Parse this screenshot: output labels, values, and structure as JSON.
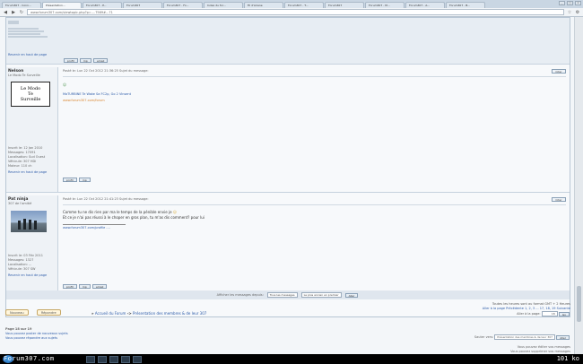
{
  "browser": {
    "tabs": [
      {
        "label": "Forum307 - Conn..."
      },
      {
        "label": "Présentation..."
      },
      {
        "label": "Forum307 - P..."
      },
      {
        "label": "Forum307"
      },
      {
        "label": "Forum307 - Fo..."
      },
      {
        "label": "Index du for..."
      },
      {
        "label": "Fil d'Ariane"
      },
      {
        "label": "Forum307 - T..."
      },
      {
        "label": "Forum307"
      },
      {
        "label": "Forum307 - M..."
      },
      {
        "label": "Forum307 - A..."
      },
      {
        "label": "Forum307 - B..."
      },
      {
        "label": "Forum307"
      },
      {
        "label": "Mes messages"
      }
    ],
    "url": "www.forum307.com/viewtopic.php?p=....7569#...71",
    "controls": [
      "_",
      "□",
      "×"
    ]
  },
  "posts": [
    {
      "author": "Nelson",
      "rank": "Le Modo Te Surveille",
      "avatar_lines": [
        "Le Modo",
        "Te",
        "Surveille"
      ],
      "meta": "Posté le: Lun 22 Oct 2012 21:36:25    Sujet du message:",
      "message_line1": "",
      "signature_link": "MaTURBINE Te Wake Sa FC2p, Go 2 Vinsent",
      "signature_orange": "www.forum307.com/forum",
      "info": [
        "Inscrit le: 12 Jan 2010",
        "Messages: 17091",
        "Localisation: Sud Ouest",
        "Véhicule: 307 HDi",
        "Moteur: 110 ch"
      ],
      "back_to_top": "Revenir en haut de page",
      "buttons": [
        "profil",
        "mp"
      ],
      "quote_label": "Citer"
    },
    {
      "author": "Pat ninja",
      "rank": "307 de l'amitié",
      "meta": "Posté le: Lun 22 Oct 2012 21:41:23    Sujet du message:",
      "message_line1": "Comme tu ne dis rien par ma le temps de la pénible envie je ",
      "message_line2": "Et ce je n'ai pas réussi à le choper en gros plan, tu m'as dis comment? pour lui",
      "signature_link": "www.forum307.com/profile ....",
      "info": [
        "Inscrit le: 03 Fév 2011",
        "Messages: 1327",
        "Localisation: ...",
        "Véhicule: 307 SW"
      ],
      "back_to_top": "Revenir en haut de page",
      "buttons": [
        "profil",
        "mp",
        "email"
      ],
      "quote_label": "Citer"
    }
  ],
  "top_fragment": {
    "back_to_top": "Revenir en haut de page",
    "buttons": [
      "profil",
      "mp",
      "email"
    ]
  },
  "sortbar": {
    "label": "Afficher les messages depuis:",
    "select1": "Tous les messages",
    "select2": "Le plus ancien en premier",
    "go": "Aller"
  },
  "bottom": {
    "new_topic": "Nouveau",
    "reply": "Répondre",
    "breadcrumb_home": "Accueil du Forum",
    "breadcrumb_sep": "->",
    "breadcrumb_section": "Présentation des membres & de leur 307",
    "pagination_tz": "Toutes les heures sont au format GMT + 2 Heures",
    "pagination_pages": "Aller à la page Précédente  1, 2, 3 ... 17, 18, 19  Suivante",
    "page_of": "Page 18 sur 19",
    "goto_label": "Aller à la page:",
    "goto_value": "18",
    "goto_btn": "Go",
    "jump_label": "Sauter vers:",
    "jump_select": "Présentation des membres & de leur 307",
    "jump_btn": "Aller",
    "perms": [
      "Vous pouvez poster de nouveaux sujets",
      "Vous pouvez répondre aux sujets"
    ],
    "perms_right": [
      "Vous pouvez éditer vos messages",
      "Vous pouvez supprimer vos messages"
    ]
  },
  "watermark": "Forum307.com",
  "speed": "101 ko"
}
